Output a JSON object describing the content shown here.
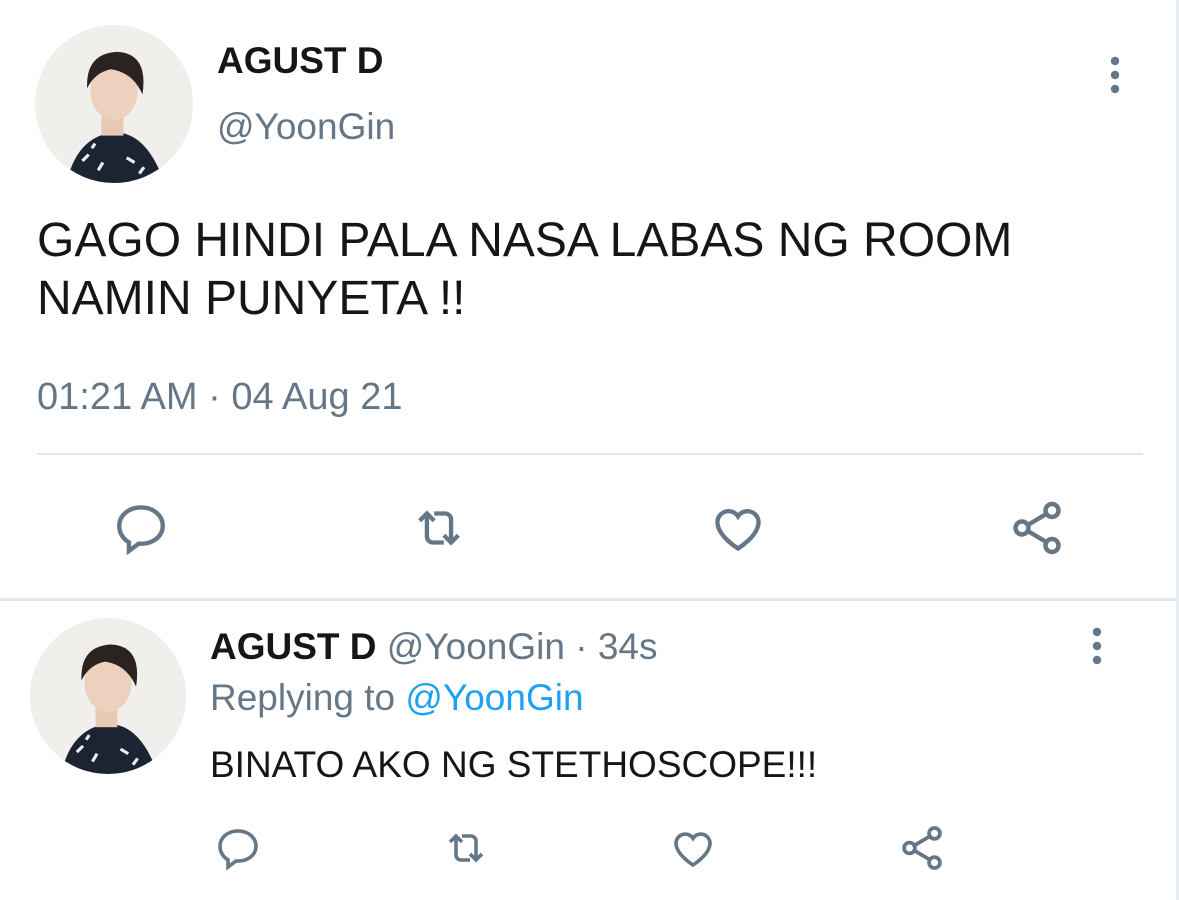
{
  "main_tweet": {
    "display_name": "AGUST D",
    "handle": "@YoonGin",
    "text_line1": "GAGO HINDI PALA NASA LABAS NG ROOM",
    "text_line2": "NAMIN PUNYETA !!",
    "timestamp": "01:21 AM · 04 Aug 21",
    "avatar_icon": "profile-photo",
    "more_icon": "more-vertical-icon"
  },
  "reply_tweet": {
    "display_name": "AGUST D",
    "handle": "@YoonGin",
    "separator": "·",
    "age": "34s",
    "replying_prefix": "Replying to",
    "replying_handle": "@YoonGin",
    "text": "BINATO AKO NG STETHOSCOPE!!!",
    "avatar_icon": "profile-photo",
    "more_icon": "more-vertical-icon"
  },
  "actions": [
    "reply-icon",
    "retweet-icon",
    "like-icon",
    "share-icon"
  ],
  "colors": {
    "text": "#14171a",
    "muted": "#657786",
    "link": "#1da1f2",
    "divider": "#e1e8ed"
  }
}
